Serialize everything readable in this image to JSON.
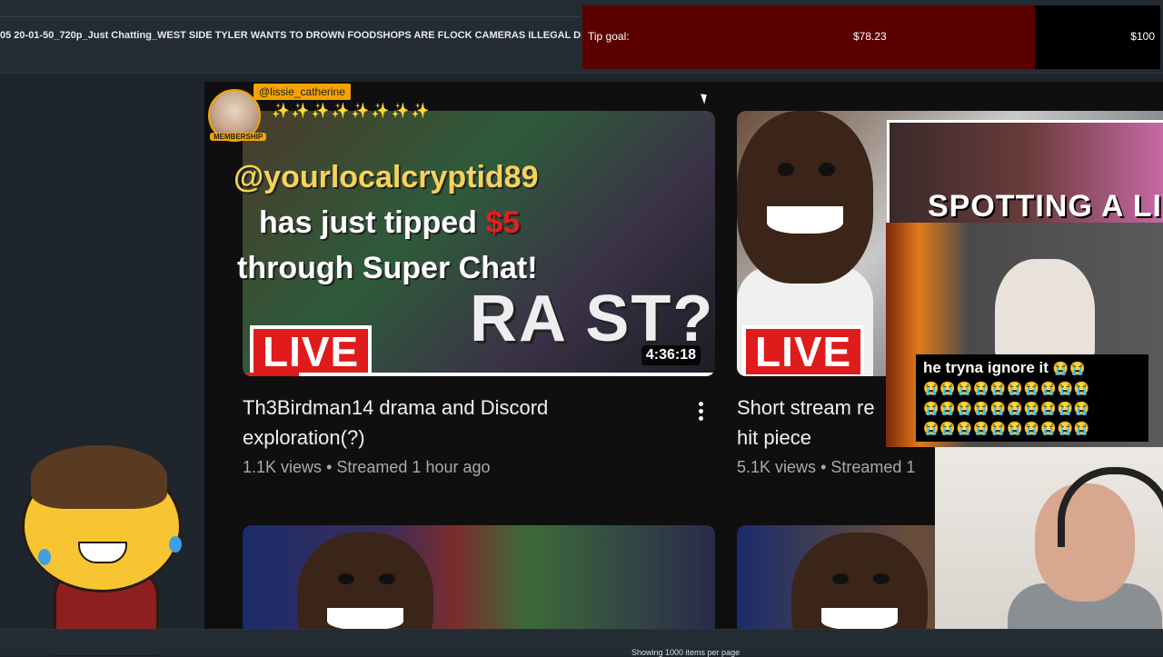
{
  "window": {
    "title": "05 20-01-50_720p_Just Chatting_WEST SIDE TYLER WANTS TO DROWN FOODSHOPS ARE FLOCK CAMERAS ILLEGAL DRAM"
  },
  "tip_goal": {
    "label": "Tip goal:",
    "current": "$78.23",
    "target": "$100",
    "progress_fraction": 0.7823,
    "fill_color": "#5a0000"
  },
  "membership_alert": {
    "handle": "@lissie_catherine",
    "badge": "MEMBERSHIP",
    "emotes": "✨✨✨✨✨✨✨✨"
  },
  "super_chat": {
    "name": "@yourlocalcryptid89",
    "line1_prefix": "has just tipped ",
    "amount": "$5",
    "line2": "through Super Chat!"
  },
  "videos": [
    {
      "live_badge": "LIVE",
      "thumbnail_text": "RA ST?",
      "duration": "4:36:18",
      "title_line1": "Th3Birdman14 drama and Discord",
      "title_line2": "exploration(?)",
      "views": "1.1K views",
      "separator": "•",
      "age": "Streamed 1 hour ago"
    },
    {
      "live_badge": "LIVE",
      "thumbnail_text": "SPOTTING A LIAR",
      "title_line1": "Short stream re",
      "title_line2": "hit piece",
      "views": "5.1K views",
      "separator": "•",
      "age": "Streamed 1"
    }
  ],
  "dog_overlay": {
    "caption": "he tryna ignore it",
    "emoji_rows": [
      "😭😭",
      "😭😭😭😭😭😭😭😭😭😭",
      "😭😭😭😭😭😭😭😭😭😭",
      "😭😭😭😭😭😭😭😭😭😭"
    ]
  },
  "footer": {
    "text": "Showing 1000 items per page"
  }
}
